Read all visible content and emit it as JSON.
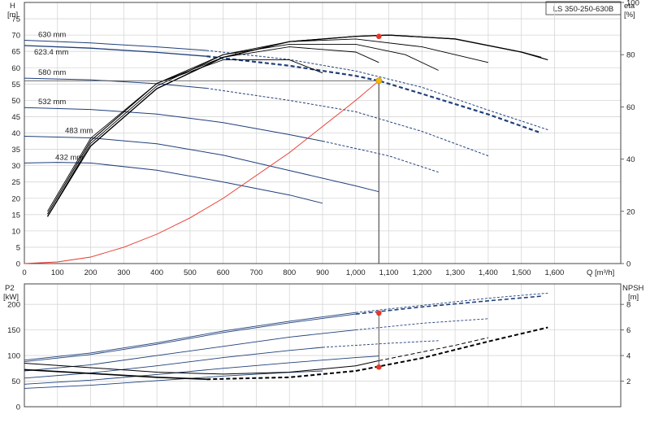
{
  "model_badge": "LS 350-250-630B",
  "colors": {
    "curve": "#1f3f7a",
    "system": "#e8362a",
    "duty": "#e8362a",
    "duty_head": "#f2b90f",
    "black": "#000000"
  },
  "chart_data": [
    {
      "type": "line",
      "name_labels": {
        "y_left": [
          "H",
          "[m]"
        ],
        "y_right": [
          "eta",
          "[%]"
        ],
        "x": "Q [m³/h]"
      },
      "x_ticks": [
        "0",
        "100",
        "200",
        "300",
        "400",
        "500",
        "600",
        "700",
        "800",
        "900",
        "1,000",
        "1,100",
        "1,200",
        "1,300",
        "1,400",
        "1,500",
        "1,600"
      ],
      "y_left_ticks": [
        "0",
        "5",
        "10",
        "15",
        "20",
        "25",
        "30",
        "35",
        "40",
        "45",
        "50",
        "55",
        "60",
        "65",
        "70",
        "75"
      ],
      "y_right_ticks": [
        "0",
        "20",
        "40",
        "60",
        "80",
        "100"
      ],
      "xlim": [
        0,
        1800
      ],
      "ylim": [
        0,
        80
      ],
      "y_right_lim": [
        0,
        100
      ],
      "head_curves": [
        {
          "name": "630 mm",
          "solid": [
            [
              0,
              68.4
            ],
            [
              200,
              67.6
            ],
            [
              400,
              66.4
            ],
            [
              550,
              65.3
            ]
          ],
          "dashed": [
            [
              550,
              65.3
            ],
            [
              800,
              62.5
            ],
            [
              1000,
              59.0
            ],
            [
              1200,
              54.0
            ],
            [
              1400,
              47.0
            ],
            [
              1580,
              41.0
            ]
          ]
        },
        {
          "name": "623.4 mm",
          "solid": [
            [
              0,
              66.8
            ],
            [
              200,
              66.0
            ],
            [
              400,
              64.7
            ],
            [
              550,
              63.5
            ]
          ],
          "dashed": [
            [
              550,
              63.5
            ],
            [
              800,
              60.6
            ],
            [
              1000,
              57.5
            ],
            [
              1070,
              56.0
            ],
            [
              1200,
              52.0
            ],
            [
              1400,
              45.7
            ],
            [
              1560,
              40.0
            ]
          ]
        },
        {
          "name": "580 mm",
          "solid": [
            [
              0,
              56.8
            ],
            [
              200,
              56.3
            ],
            [
              400,
              55.1
            ],
            [
              550,
              53.7
            ]
          ],
          "dashed": [
            [
              550,
              53.7
            ],
            [
              800,
              50.0
            ],
            [
              1000,
              46.5
            ],
            [
              1200,
              40.5
            ],
            [
              1400,
              33.0
            ]
          ]
        },
        {
          "name": "532 mm",
          "solid": [
            [
              0,
              47.8
            ],
            [
              200,
              47.2
            ],
            [
              400,
              45.8
            ],
            [
              600,
              43.2
            ],
            [
              800,
              39.5
            ],
            [
              900,
              37.5
            ]
          ],
          "dashed": [
            [
              900,
              37.5
            ],
            [
              1100,
              33.0
            ],
            [
              1250,
              28.0
            ]
          ]
        },
        {
          "name": "483 mm",
          "solid": [
            [
              0,
              39.0
            ],
            [
              200,
              38.5
            ],
            [
              400,
              36.7
            ],
            [
              600,
              33.2
            ],
            [
              800,
              28.5
            ],
            [
              1000,
              23.8
            ],
            [
              1070,
              22.0
            ]
          ],
          "dashed": []
        },
        {
          "name": "432 mm",
          "solid": [
            [
              0,
              30.8
            ],
            [
              100,
              31.0
            ],
            [
              200,
              30.8
            ],
            [
              400,
              28.6
            ],
            [
              600,
              25.0
            ],
            [
              800,
              21.0
            ],
            [
              900,
              18.5
            ]
          ],
          "dashed": []
        }
      ],
      "efficiency_curves": [
        {
          "name": "630 mm",
          "points": [
            [
              70,
              18
            ],
            [
              200,
              45
            ],
            [
              400,
              67
            ],
            [
              600,
              79
            ],
            [
              800,
              85
            ],
            [
              1000,
              87
            ],
            [
              1100,
              87.5
            ],
            [
              1300,
              86
            ],
            [
              1500,
              81
            ],
            [
              1580,
              78
            ]
          ]
        },
        {
          "name": "623.4 mm",
          "points": [
            [
              70,
              18
            ],
            [
              200,
              45
            ],
            [
              400,
              67
            ],
            [
              600,
              79
            ],
            [
              800,
              85
            ],
            [
              1000,
              87
            ],
            [
              1100,
              87.5
            ],
            [
              1300,
              86
            ],
            [
              1500,
              81
            ],
            [
              1560,
              79
            ]
          ]
        },
        {
          "name": "580 mm",
          "points": [
            [
              70,
              18
            ],
            [
              200,
              46
            ],
            [
              400,
              68
            ],
            [
              600,
              80
            ],
            [
              800,
              85
            ],
            [
              1000,
              86
            ],
            [
              1200,
              83
            ],
            [
              1400,
              77
            ]
          ]
        },
        {
          "name": "532 mm",
          "points": [
            [
              70,
              19
            ],
            [
              200,
              47
            ],
            [
              400,
              69
            ],
            [
              600,
              80
            ],
            [
              800,
              84
            ],
            [
              1000,
              84
            ],
            [
              1150,
              80
            ],
            [
              1250,
              74
            ]
          ]
        },
        {
          "name": "483 mm",
          "points": [
            [
              70,
              19
            ],
            [
              200,
              47
            ],
            [
              400,
              69
            ],
            [
              600,
              79
            ],
            [
              800,
              83
            ],
            [
              1000,
              81
            ],
            [
              1070,
              77
            ]
          ]
        },
        {
          "name": "432 mm",
          "points": [
            [
              70,
              20
            ],
            [
              200,
              48
            ],
            [
              400,
              69
            ],
            [
              600,
              78
            ],
            [
              800,
              78
            ],
            [
              900,
              73
            ]
          ]
        }
      ],
      "system_curve": [
        [
          0,
          0
        ],
        [
          100,
          0.5
        ],
        [
          200,
          2
        ],
        [
          300,
          5
        ],
        [
          400,
          9
        ],
        [
          500,
          14
        ],
        [
          600,
          20
        ],
        [
          700,
          27
        ],
        [
          800,
          34
        ],
        [
          900,
          42
        ],
        [
          1000,
          50
        ],
        [
          1070,
          56
        ]
      ],
      "duty_point": {
        "q": 1070,
        "head": 56,
        "eta": 87
      }
    },
    {
      "type": "line",
      "name_labels": {
        "y_left": [
          "P2",
          "[kW]"
        ],
        "y_right": [
          "NPSH",
          "[m]"
        ]
      },
      "y_left_ticks": [
        "0",
        "50",
        "100",
        "150",
        "200"
      ],
      "y_right_ticks": [
        "2",
        "4",
        "6",
        "8"
      ],
      "xlim": [
        0,
        1800
      ],
      "ylim": [
        0,
        240
      ],
      "y_right_lim": [
        0,
        9.6
      ],
      "power_curves": [
        {
          "name": "630 mm",
          "solid": [
            [
              0,
              91
            ],
            [
              200,
              105
            ],
            [
              400,
              125
            ],
            [
              600,
              148
            ],
            [
              800,
              167
            ],
            [
              1000,
              184
            ]
          ],
          "dashed": [
            [
              1000,
              184
            ],
            [
              1200,
              198
            ],
            [
              1400,
              212
            ],
            [
              1580,
              222
            ]
          ]
        },
        {
          "name": "623.4 mm",
          "solid": [
            [
              0,
              88
            ],
            [
              200,
              102
            ],
            [
              400,
              122
            ],
            [
              600,
              145
            ],
            [
              800,
              164
            ],
            [
              1000,
              181
            ]
          ],
          "dashed": [
            [
              1000,
              181
            ],
            [
              1200,
              195
            ],
            [
              1400,
              207
            ],
            [
              1560,
              216
            ]
          ]
        },
        {
          "name": "580 mm",
          "solid": [
            [
              0,
              70
            ],
            [
              200,
              82
            ],
            [
              400,
              100
            ],
            [
              600,
              118
            ],
            [
              800,
              136
            ],
            [
              1000,
              150
            ]
          ],
          "dashed": [
            [
              1000,
              150
            ],
            [
              1200,
              163
            ],
            [
              1400,
              172
            ]
          ]
        },
        {
          "name": "532 mm",
          "solid": [
            [
              0,
              56
            ],
            [
              200,
              66
            ],
            [
              400,
              80
            ],
            [
              600,
              96
            ],
            [
              800,
              110
            ],
            [
              900,
              116
            ]
          ],
          "dashed": [
            [
              900,
              116
            ],
            [
              1100,
              124
            ],
            [
              1250,
              129
            ]
          ]
        },
        {
          "name": "483 mm",
          "solid": [
            [
              0,
              44
            ],
            [
              200,
              52
            ],
            [
              400,
              63
            ],
            [
              600,
              75
            ],
            [
              800,
              86
            ],
            [
              1000,
              96
            ],
            [
              1070,
              99
            ]
          ],
          "dashed": []
        },
        {
          "name": "432 mm",
          "solid": [
            [
              0,
              36
            ],
            [
              200,
              42
            ],
            [
              400,
              51
            ],
            [
              600,
              60
            ],
            [
              800,
              67
            ],
            [
              900,
              70
            ]
          ],
          "dashed": []
        }
      ],
      "npsh_curves": [
        {
          "name": "630 mm",
          "solid": [
            [
              0,
              2.9
            ],
            [
              200,
              2.6
            ],
            [
              400,
              2.3
            ],
            [
              550,
              2.15
            ]
          ],
          "dashed": [
            [
              550,
              2.15
            ],
            [
              800,
              2.3
            ],
            [
              1000,
              2.8
            ],
            [
              1200,
              3.8
            ],
            [
              1400,
              5.1
            ],
            [
              1580,
              6.2
            ]
          ]
        },
        {
          "name": "580 mm",
          "solid": [
            [
              0,
              3.4
            ],
            [
              200,
              3.05
            ],
            [
              400,
              2.7
            ],
            [
              600,
              2.55
            ],
            [
              800,
              2.7
            ],
            [
              1000,
              3.2
            ],
            [
              1070,
              3.6
            ]
          ],
          "dashed": [
            [
              1070,
              3.6
            ],
            [
              1300,
              4.8
            ],
            [
              1400,
              5.4
            ]
          ]
        }
      ],
      "duty_power": {
        "q": 1070,
        "p2": 183
      },
      "duty_npsh": {
        "q": 1070,
        "npsh": 3.1
      }
    }
  ]
}
